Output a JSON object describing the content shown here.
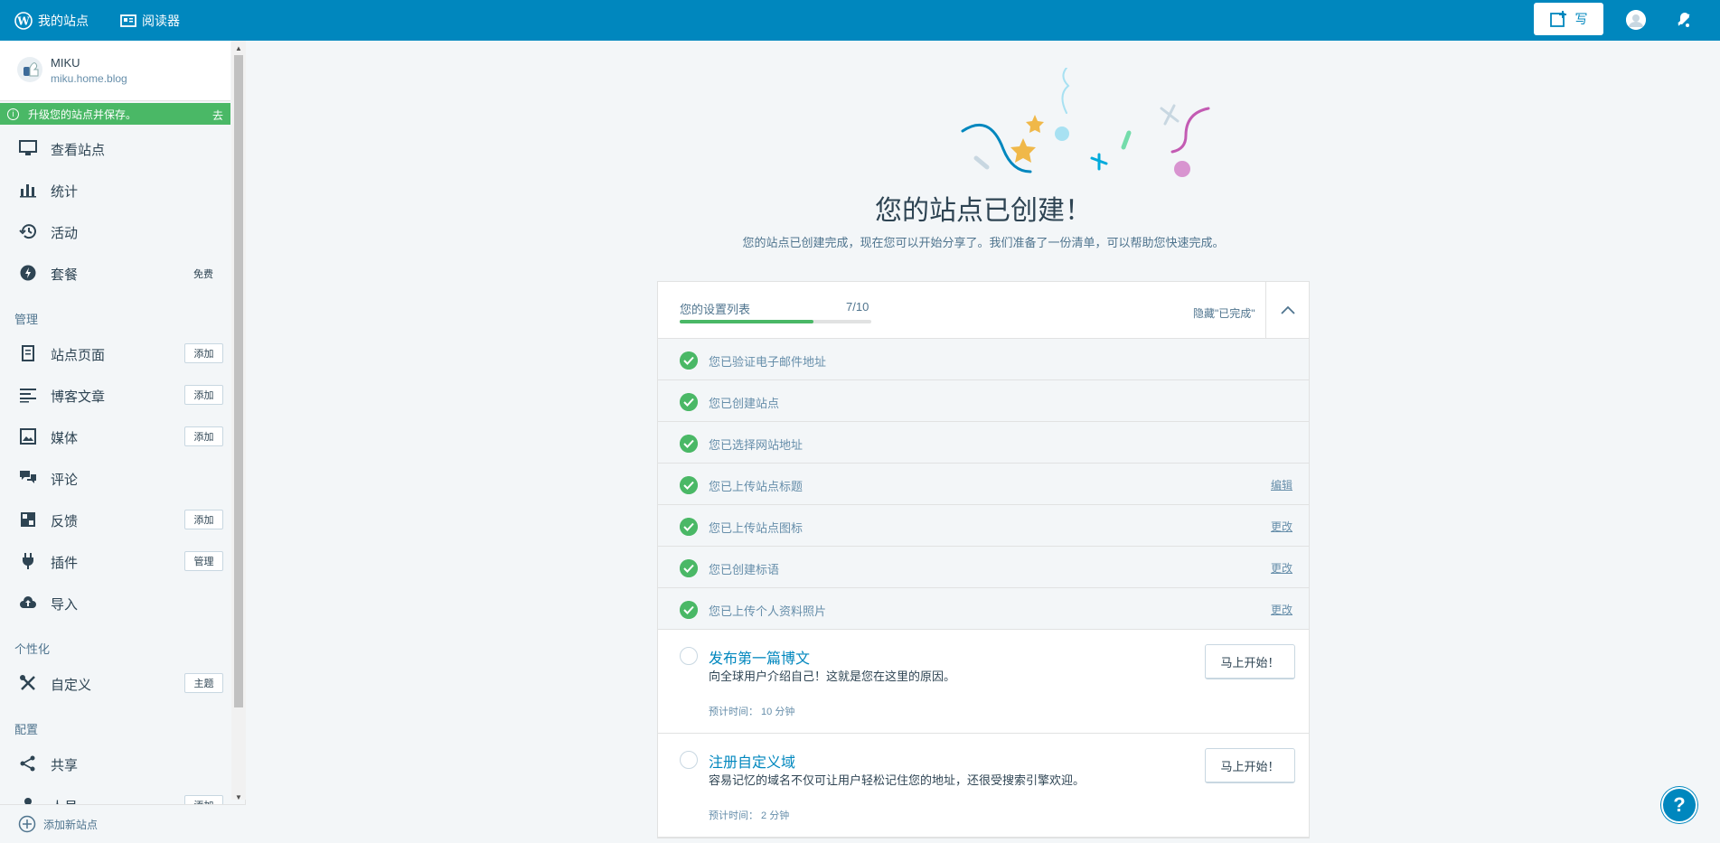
{
  "topbar": {
    "my_site": "我的站点",
    "reader": "阅读器",
    "write": "写"
  },
  "sidebar": {
    "site_name": "MIKU",
    "site_url": "miku.home.blog",
    "upgrade_text": "升级您的站点并保存。",
    "upgrade_go": "去",
    "items": [
      {
        "label": "查看站点",
        "icon": "computer-icon"
      },
      {
        "label": "统计",
        "icon": "stats-icon"
      },
      {
        "label": "活动",
        "icon": "history-icon"
      },
      {
        "label": "套餐",
        "icon": "plans-icon",
        "badge": "免费"
      }
    ],
    "section_manage": "管理",
    "manage_items": [
      {
        "label": "站点页面",
        "button": "添加"
      },
      {
        "label": "博客文章",
        "button": "添加"
      },
      {
        "label": "媒体",
        "button": "添加"
      },
      {
        "label": "评论"
      },
      {
        "label": "反馈",
        "button": "添加"
      },
      {
        "label": "插件",
        "button": "管理"
      },
      {
        "label": "导入"
      }
    ],
    "section_personalize": "个性化",
    "personalize_items": [
      {
        "label": "自定义",
        "button": "主题"
      }
    ],
    "section_configure": "配置",
    "configure_items": [
      {
        "label": "共享"
      },
      {
        "label": "人员",
        "button": "添加"
      }
    ],
    "add_site": "添加新站点"
  },
  "main": {
    "title": "您的站点已创建！",
    "subtitle": "您的站点已创建完成，现在您可以开始分享了。我们准备了一份清单，可以帮助您快速完成。",
    "checklist": {
      "title": "您的设置列表",
      "count": "7/10",
      "progress": 0.7,
      "hide_completed": "隐藏\"已完成\"",
      "done_tasks": [
        {
          "label": "您已验证电子邮件地址",
          "link": ""
        },
        {
          "label": "您已创建站点",
          "link": ""
        },
        {
          "label": "您已选择网站地址",
          "link": ""
        },
        {
          "label": "您已上传站点标题",
          "link": "编辑"
        },
        {
          "label": "您已上传站点图标",
          "link": "更改"
        },
        {
          "label": "您已创建标语",
          "link": "更改"
        },
        {
          "label": "您已上传个人资料照片",
          "link": "更改"
        }
      ],
      "open_tasks": [
        {
          "title": "发布第一篇博文",
          "desc": "向全球用户介绍自己！这就是您在这里的原因。",
          "time": "预计时间： 10 分钟",
          "button": "马上开始！"
        },
        {
          "title": "注册自定义域",
          "desc": "容易记忆的域名不仅可让用户轻松记住您的地址，还很受搜索引擎欢迎。",
          "time": "预计时间： 2 分钟",
          "button": "马上开始！"
        }
      ]
    }
  },
  "colors": {
    "topbar": "#0087be",
    "success": "#4ab866",
    "link": "#0087be"
  }
}
